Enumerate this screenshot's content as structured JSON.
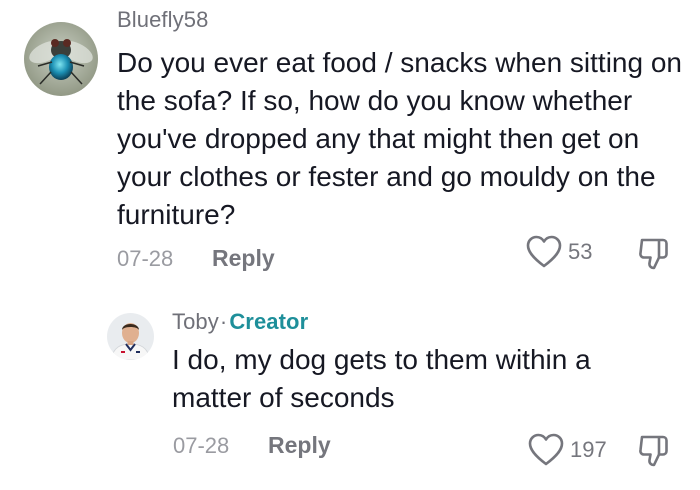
{
  "comments": [
    {
      "username": "Bluefly58",
      "text": "Do you ever eat food / snacks when sitting on the sofa? If so, how do you know whether you've dropped any that might then get on your clothes or fester and go mouldy on the furniture?",
      "date": "07-28",
      "reply_label": "Reply",
      "likes": "53",
      "avatar_icon": "fly-photo-avatar",
      "like_icon": "heart-outline-icon",
      "dislike_icon": "thumbs-down-outline-icon"
    },
    {
      "username": "Toby",
      "separator": "·",
      "badge": "Creator",
      "text": "I do, my dog gets to them within a matter of seconds",
      "date": "07-28",
      "reply_label": "Reply",
      "likes": "197",
      "avatar_icon": "person-photo-avatar",
      "like_icon": "heart-outline-icon",
      "dislike_icon": "thumbs-down-outline-icon"
    }
  ],
  "colors": {
    "text": "#161823",
    "muted": "#6f7078",
    "creator_badge": "#1e8f9a"
  }
}
